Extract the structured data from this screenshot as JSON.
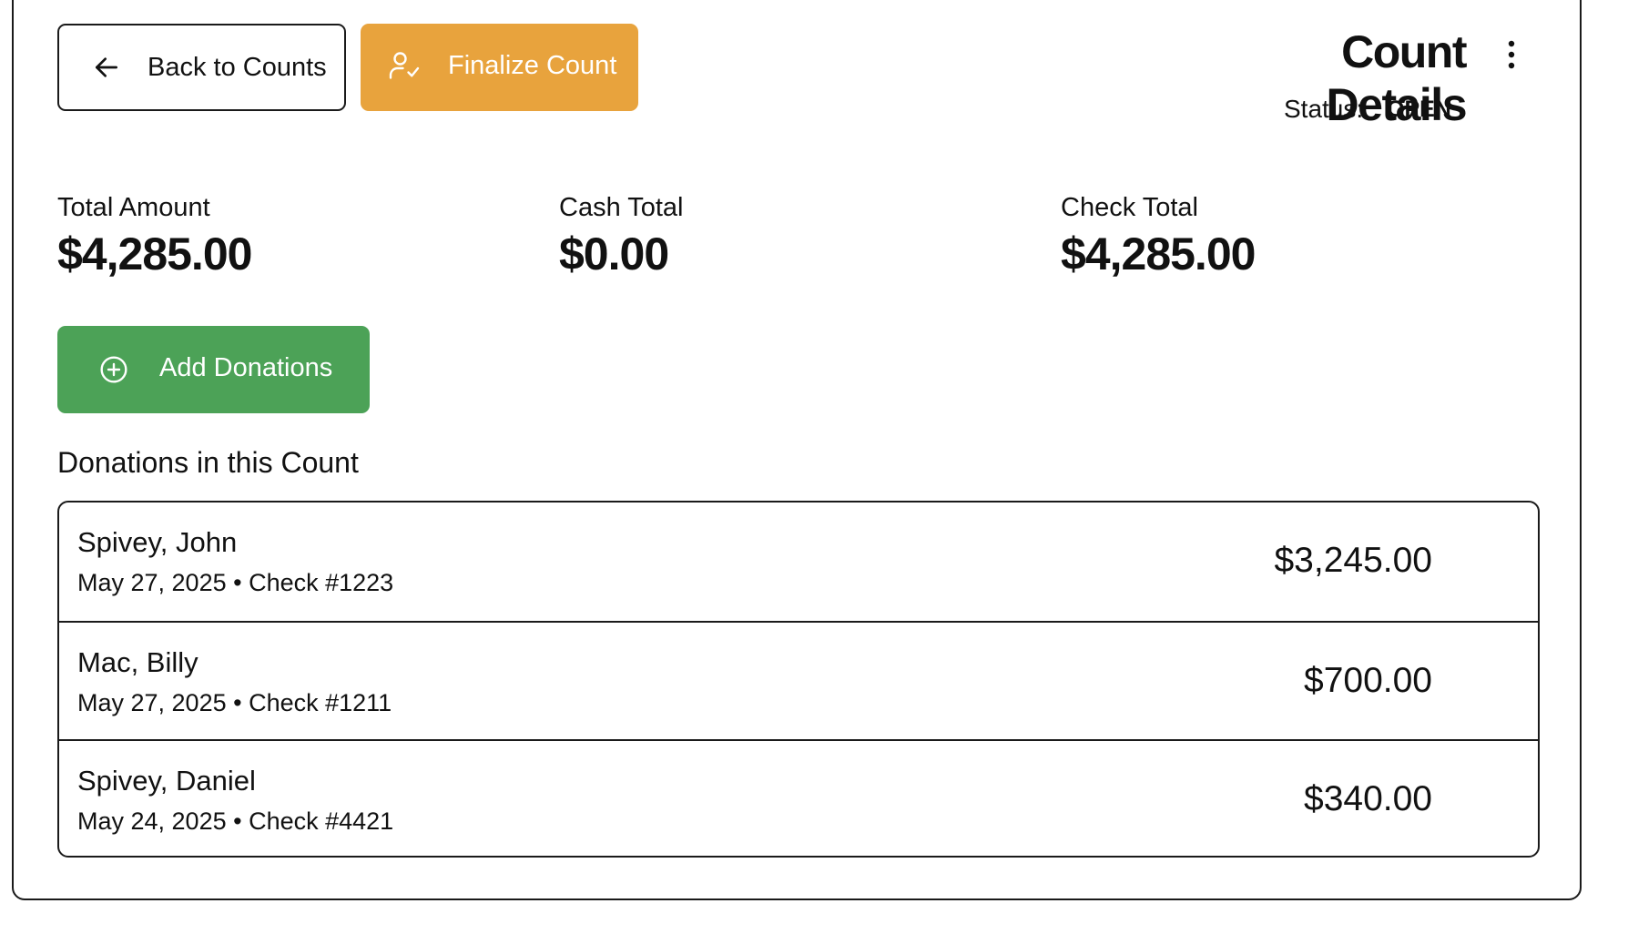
{
  "header": {
    "back_label": "Back to Counts",
    "back_icon": "arrow-left-icon",
    "finalize_label": "Finalize Count",
    "finalize_icon": "user-check-icon",
    "title": "Count Details",
    "menu_icon": "more-vertical-icon",
    "status_label": "Status:",
    "status_value": "OPEN"
  },
  "summary": {
    "total_label": "Total Amount",
    "total_value": "$4,285.00",
    "cash_label": "Cash Total",
    "cash_value": "$0.00",
    "check_label": "Check Total",
    "check_value": "$4,285.00"
  },
  "actions": {
    "add_label": "Add Donations",
    "add_icon": "plus-circle-icon"
  },
  "donations": {
    "title": "Donations in this Count",
    "items": [
      {
        "name": "Spivey, John",
        "meta": "May 27, 2025 • Check #1223",
        "amount": "$3,245.00"
      },
      {
        "name": "Mac, Billy",
        "meta": "May 27, 2025 • Check #1211",
        "amount": "$700.00"
      },
      {
        "name": "Spivey, Daniel",
        "meta": "May 24, 2025 • Check #4421",
        "amount": "$340.00"
      }
    ]
  },
  "colors": {
    "finalize": "#e8a33d",
    "add": "#4ca257",
    "border": "#1a1a1a"
  }
}
